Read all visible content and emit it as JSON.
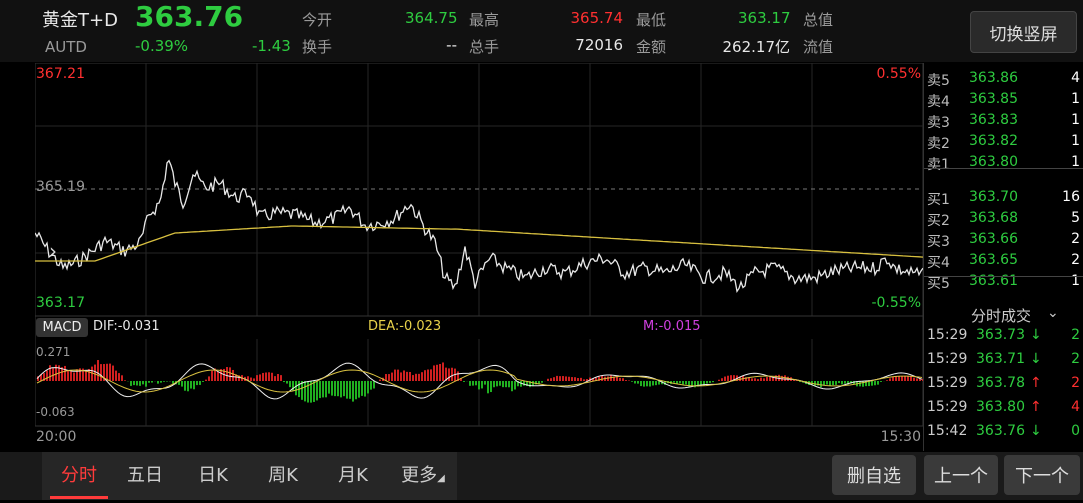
{
  "header": {
    "name": "黄金T+D",
    "code": "AUTD",
    "price": "363.76",
    "change_pct": "-0.39%",
    "change": "-1.43",
    "fields": [
      {
        "label": "今开",
        "value": "364.75",
        "color": "#2ecc40"
      },
      {
        "label": "最高",
        "value": "365.74",
        "color": "#ff3030"
      },
      {
        "label": "最低",
        "value": "363.17",
        "color": "#2ecc40"
      },
      {
        "label": "总值",
        "value": ""
      },
      {
        "label": "换手",
        "value": "--",
        "color": "#dddddd"
      },
      {
        "label": "总手",
        "value": "72016",
        "color": "#ffffff"
      },
      {
        "label": "金额",
        "value": "262.17亿",
        "color": "#ffffff"
      },
      {
        "label": "流值",
        "value": ""
      }
    ],
    "switch_label": "切换竖屏"
  },
  "chart": {
    "top_price": "367.21",
    "mid_price": "365.19",
    "bottom_price": "363.17",
    "top_pct": "0.55%",
    "bottom_pct": "-0.55%",
    "macd_label": "MACD",
    "dif": "DIF:-0.031",
    "dea": "DEA:-0.023",
    "m": "M:-0.015",
    "macd_top": "0.271",
    "macd_bottom": "-0.063",
    "time_start": "20:00",
    "time_end": "15:30"
  },
  "orderbook": {
    "sell": [
      {
        "label": "卖5",
        "price": "363.86",
        "vol": "4"
      },
      {
        "label": "卖4",
        "price": "363.85",
        "vol": "1"
      },
      {
        "label": "卖3",
        "price": "363.83",
        "vol": "1"
      },
      {
        "label": "卖2",
        "price": "363.82",
        "vol": "1"
      },
      {
        "label": "卖1",
        "price": "363.80",
        "vol": "1"
      }
    ],
    "buy": [
      {
        "label": "买1",
        "price": "363.70",
        "vol": "16"
      },
      {
        "label": "买2",
        "price": "363.68",
        "vol": "5"
      },
      {
        "label": "买3",
        "price": "363.66",
        "vol": "2"
      },
      {
        "label": "买4",
        "price": "363.65",
        "vol": "2"
      },
      {
        "label": "买5",
        "price": "363.61",
        "vol": "1"
      }
    ],
    "ticks_title": "分时成交",
    "ticks": [
      {
        "time": "15:29",
        "price": "363.73",
        "arrow": "↓",
        "vol": "2",
        "dir": "down"
      },
      {
        "time": "15:29",
        "price": "363.71",
        "arrow": "↓",
        "vol": "2",
        "dir": "down"
      },
      {
        "time": "15:29",
        "price": "363.78",
        "arrow": "↑",
        "vol": "2",
        "dir": "up"
      },
      {
        "time": "15:29",
        "price": "363.80",
        "arrow": "↑",
        "vol": "4",
        "dir": "up"
      },
      {
        "time": "15:42",
        "price": "363.76",
        "arrow": "↓",
        "vol": "0",
        "dir": "down"
      }
    ]
  },
  "tabs": [
    "分时",
    "五日",
    "日K",
    "周K",
    "月K",
    "更多"
  ],
  "buttons": {
    "remove_fav": "删自选",
    "prev": "上一个",
    "next": "下一个"
  }
}
